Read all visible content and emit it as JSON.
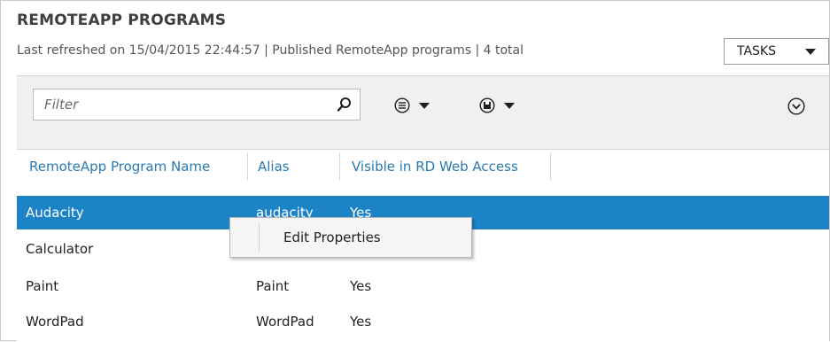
{
  "header": {
    "title": "REMOTEAPP PROGRAMS",
    "subtitle": "Last refreshed on 15/04/2015 22:44:57 | Published RemoteApp programs  | 4 total",
    "tasks_label": "TASKS"
  },
  "toolbar": {
    "filter_placeholder": "Filter",
    "icons": [
      "search-icon",
      "list-view-icon",
      "save-icon",
      "expand-icon"
    ]
  },
  "table": {
    "columns": [
      "RemoteApp Program Name",
      "Alias",
      "Visible in RD Web Access"
    ],
    "rows": [
      {
        "name": "Audacity",
        "alias": "audacity",
        "visible": "Yes",
        "selected": true
      },
      {
        "name": "Calculator",
        "alias": "",
        "visible": "",
        "selected": false
      },
      {
        "name": "Paint",
        "alias": "Paint",
        "visible": "Yes",
        "selected": false
      },
      {
        "name": "WordPad",
        "alias": "WordPad",
        "visible": "Yes",
        "selected": false
      }
    ]
  },
  "context_menu": {
    "items": [
      "Edit Properties"
    ]
  },
  "colors": {
    "selection": "#1c84c6",
    "header_link": "#2a7ab0",
    "toolbar_bg": "#f0f0f0"
  }
}
